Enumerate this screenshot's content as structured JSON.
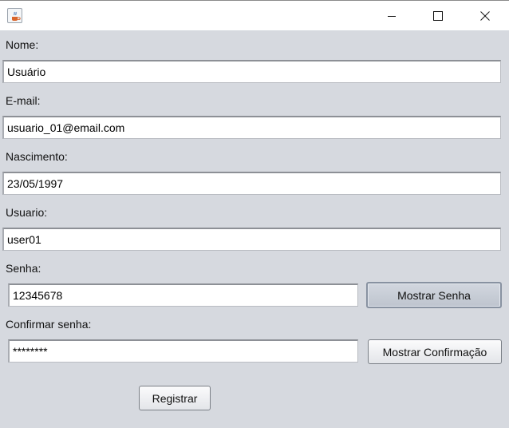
{
  "titlebar": {
    "icon": "java-cup-icon",
    "controls": [
      "minimize-icon",
      "maximize-icon",
      "close-icon"
    ]
  },
  "form": {
    "nome": {
      "label": "Nome:",
      "value": "Usuário"
    },
    "email": {
      "label": "E-mail:",
      "value": "usuario_01@email.com"
    },
    "nascimento": {
      "label": "Nascimento:",
      "value": "23/05/1997"
    },
    "usuario": {
      "label": "Usuario:",
      "value": "user01"
    },
    "senha": {
      "label": "Senha:",
      "value": "12345678",
      "toggle_label": "Mostrar Senha"
    },
    "confirmar": {
      "label": "Confirmar senha:",
      "value": "********",
      "toggle_label": "Mostrar Confirmação"
    },
    "submit_label": "Registrar"
  }
}
